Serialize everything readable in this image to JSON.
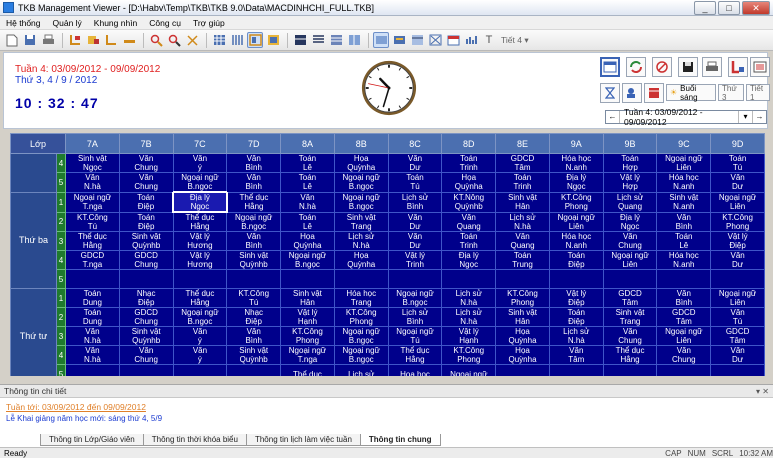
{
  "window": {
    "title": "TKB Management Viewer - [D:\\Habv\\Temp\\TKB\\TKB 9.0\\Data\\MACDINHCHI_FULL.TKB]",
    "min": "_",
    "max": "□",
    "close": "✕"
  },
  "menu": [
    "Hệ thống",
    "Quản lý",
    "Khung nhìn",
    "Công cụ",
    "Trợ giúp"
  ],
  "toolbar": {
    "tiet_label": "Tiết 4",
    "tiet_arrow": "▾"
  },
  "header": {
    "week": "Tuần 4: 03/09/2012 - 09/09/2012",
    "day": "Thứ 3, 4 / 9 / 2012",
    "time": "10 : 32 : 47",
    "session_label": "Buổi sáng",
    "day_select": "Thứ 3",
    "period_select": "Tiết 1",
    "week_select": "Tuần 4: 03/09/2012 - 09/09/2012",
    "nav_prev": "←",
    "nav_next": "→",
    "nav_drop": "▾"
  },
  "clock": {
    "hour": 10,
    "minute": 32,
    "second": 47
  },
  "grid": {
    "corner": "Lớp",
    "classes": [
      "7A",
      "7B",
      "7C",
      "7D",
      "8A",
      "8B",
      "8C",
      "8D",
      "8E",
      "9A",
      "9B",
      "9C",
      "9D"
    ],
    "sections": [
      {
        "day": "",
        "rows": [
          {
            "period": "4",
            "cells": [
              [
                "Sinh vật",
                "Ngọc"
              ],
              [
                "Văn",
                "Chung"
              ],
              [
                "Văn",
                "ý"
              ],
              [
                "Văn",
                "Bình"
              ],
              [
                "Toán",
                "Lê"
              ],
              [
                "Họa",
                "Quỳnha"
              ],
              [
                "Văn",
                "Dư"
              ],
              [
                "Toán",
                "Trinh"
              ],
              [
                "GDCD",
                "Tâm"
              ],
              [
                "Hóa học",
                "N.anh"
              ],
              [
                "Toán",
                "Hợp"
              ],
              [
                "Ngoại ngữ",
                "Liên"
              ],
              [
                "Toán",
                "Tú"
              ]
            ]
          },
          {
            "period": "5",
            "cells": [
              [
                "Văn",
                "N.hà"
              ],
              [
                "Văn",
                "Chung"
              ],
              [
                "Ngoại ngữ",
                "B.ngọc"
              ],
              [
                "Văn",
                "Bình"
              ],
              [
                "Toán",
                "Lê"
              ],
              [
                "Ngoại ngữ",
                "B.ngọc"
              ],
              [
                "Toán",
                "Tú"
              ],
              [
                "Họa",
                "Quỳnha"
              ],
              [
                "Toán",
                "Trinh"
              ],
              [
                "Địa lý",
                "Ngọc"
              ],
              [
                "Vật lý",
                "Hợp"
              ],
              [
                "Hóa học",
                "N.anh"
              ],
              [
                "Văn",
                "Dư"
              ]
            ]
          }
        ]
      },
      {
        "day": "Thứ ba",
        "rows": [
          {
            "period": "1",
            "cells": [
              [
                "Ngoại ngữ",
                "T.nga"
              ],
              [
                "Toán",
                "Điệp"
              ],
              [
                "Địa lý",
                "Ngọc"
              ],
              [
                "Thể dục",
                "Hằng"
              ],
              [
                "Văn",
                "N.hà"
              ],
              [
                "Ngoại ngữ",
                "B.ngọc"
              ],
              [
                "Lịch sử",
                "Bình"
              ],
              [
                "KT.Nông",
                "Quỳnhb"
              ],
              [
                "Sinh vật",
                "Hân"
              ],
              [
                "KT.Công",
                "Phong"
              ],
              [
                "Lịch sử",
                "Quang"
              ],
              [
                "Sinh vật",
                "N.anh"
              ],
              [
                "Ngoại ngữ",
                "Liên"
              ]
            ]
          },
          {
            "period": "2",
            "cells": [
              [
                "KT.Công",
                "Tú"
              ],
              [
                "Toán",
                "Điệp"
              ],
              [
                "Thể dục",
                "Hằng"
              ],
              [
                "Ngoại ngữ",
                "B.ngọc"
              ],
              [
                "Toán",
                "Lê"
              ],
              [
                "Sinh vật",
                "Trang"
              ],
              [
                "Văn",
                "Dư"
              ],
              [
                "Văn",
                "Quang"
              ],
              [
                "Lịch sử",
                "N.hà"
              ],
              [
                "Ngoại ngữ",
                "Liên"
              ],
              [
                "Địa lý",
                "Ngọc"
              ],
              [
                "Văn",
                "Bình"
              ],
              [
                "KT.Công",
                "Phong"
              ]
            ]
          },
          {
            "period": "3",
            "cells": [
              [
                "Thể dục",
                "Hằng"
              ],
              [
                "Sinh vật",
                "Quỳnhb"
              ],
              [
                "Vật lý",
                "Hương"
              ],
              [
                "Văn",
                "Bình"
              ],
              [
                "Họa",
                "Quỳnha"
              ],
              [
                "Lịch sử",
                "N.hà"
              ],
              [
                "Văn",
                "Dư"
              ],
              [
                "Toán",
                "Trinh"
              ],
              [
                "Văn",
                "Quang"
              ],
              [
                "Hóa học",
                "N.anh"
              ],
              [
                "Văn",
                "Chung"
              ],
              [
                "Toán",
                "Lê"
              ],
              [
                "Vật lý",
                "Điệp"
              ]
            ]
          },
          {
            "period": "4",
            "cells": [
              [
                "GDCD",
                "T.nga"
              ],
              [
                "GDCD",
                "Chung"
              ],
              [
                "Vật lý",
                "Hương"
              ],
              [
                "Sinh vật",
                "Quỳnhb"
              ],
              [
                "Ngoại ngữ",
                "B.ngọc"
              ],
              [
                "Họa",
                "Quỳnha"
              ],
              [
                "Vật lý",
                "Trinh"
              ],
              [
                "Địa lý",
                "Ngọc"
              ],
              [
                "Toán",
                "Trung"
              ],
              [
                "Toán",
                "Điệp"
              ],
              [
                "Ngoại ngữ",
                "Liên"
              ],
              [
                "Hóa học",
                "N.anh"
              ],
              [
                "Văn",
                "Dư"
              ]
            ]
          },
          {
            "period": "5",
            "cells": [
              [
                "",
                ""
              ],
              [
                "",
                ""
              ],
              [
                "",
                ""
              ],
              [
                "",
                ""
              ],
              [
                "",
                ""
              ],
              [
                "",
                ""
              ],
              [
                "",
                ""
              ],
              [
                "",
                ""
              ],
              [
                "",
                ""
              ],
              [
                "",
                ""
              ],
              [
                "",
                ""
              ],
              [
                "",
                ""
              ],
              [
                "",
                ""
              ]
            ]
          }
        ]
      },
      {
        "day": "Thứ tư",
        "rows": [
          {
            "period": "1",
            "cells": [
              [
                "Toán",
                "Dung"
              ],
              [
                "Nhạc",
                "Điệp"
              ],
              [
                "Thể dục",
                "Hằng"
              ],
              [
                "KT.Công",
                "Tú"
              ],
              [
                "Sinh vật",
                "Hân"
              ],
              [
                "Hóa học",
                "Trang"
              ],
              [
                "Ngoại ngữ",
                "B.ngọc"
              ],
              [
                "Lịch sử",
                "N.hà"
              ],
              [
                "KT.Công",
                "Phong"
              ],
              [
                "Vật lý",
                "Điệp"
              ],
              [
                "GDCD",
                "Tâm"
              ],
              [
                "Văn",
                "Bình"
              ],
              [
                "Ngoại ngữ",
                "Liên"
              ]
            ]
          },
          {
            "period": "2",
            "cells": [
              [
                "Toán",
                "Dung"
              ],
              [
                "GDCD",
                "Chung"
              ],
              [
                "Ngoại ngữ",
                "B.ngọc"
              ],
              [
                "Nhạc",
                "Điệp"
              ],
              [
                "Vật lý",
                "Hạnh"
              ],
              [
                "KT.Công",
                "Phong"
              ],
              [
                "Lịch sử",
                "Bình"
              ],
              [
                "Lịch sử",
                "N.hà"
              ],
              [
                "Sinh vật",
                "Hân"
              ],
              [
                "Toán",
                "Điệp"
              ],
              [
                "Sinh vật",
                "Trang"
              ],
              [
                "GDCD",
                "Tâm"
              ],
              [
                "Văn",
                "Tú"
              ]
            ]
          },
          {
            "period": "3",
            "cells": [
              [
                "Văn",
                "N.hà"
              ],
              [
                "Sinh vật",
                "Quỳnhb"
              ],
              [
                "Văn",
                "ý"
              ],
              [
                "Văn",
                "Bình"
              ],
              [
                "KT.Công",
                "Phong"
              ],
              [
                "Ngoại ngữ",
                "B.ngọc"
              ],
              [
                "Ngoại ngữ",
                "Tú"
              ],
              [
                "Vật lý",
                "Hạnh"
              ],
              [
                "Họa",
                "Quỳnha"
              ],
              [
                "Lịch sử",
                "N.hà"
              ],
              [
                "Văn",
                "Chung"
              ],
              [
                "Ngoại ngữ",
                "Liên"
              ],
              [
                "GDCD",
                "Tâm"
              ]
            ]
          },
          {
            "period": "4",
            "cells": [
              [
                "Văn",
                "N.hà"
              ],
              [
                "Văn",
                "Chung"
              ],
              [
                "Văn",
                "ý"
              ],
              [
                "Sinh vật",
                "Quỳnhb"
              ],
              [
                "Ngoại ngữ",
                "T.nga"
              ],
              [
                "Ngoại ngữ",
                "B.ngọc"
              ],
              [
                "Thể dục",
                "Hằng"
              ],
              [
                "KT.Công",
                "Phong"
              ],
              [
                "Họa",
                "Quỳnha"
              ],
              [
                "Văn",
                "Tâm"
              ],
              [
                "Thể dục",
                "Hằng"
              ],
              [
                "Văn",
                "Chung"
              ],
              [
                "Văn",
                "Dư"
              ]
            ]
          },
          {
            "period": "5",
            "cells": [
              [
                "",
                ""
              ],
              [
                "",
                ""
              ],
              [
                "",
                ""
              ],
              [
                "",
                ""
              ],
              [
                "Thể dục",
                ""
              ],
              [
                "Lịch sử",
                ""
              ],
              [
                "Họa hoc",
                ""
              ],
              [
                "Ngoại ngữ",
                ""
              ],
              [
                "",
                ""
              ],
              [
                "",
                ""
              ],
              [
                "",
                ""
              ],
              [
                "",
                ""
              ],
              [
                "",
                ""
              ]
            ]
          }
        ]
      }
    ]
  },
  "info": {
    "title": "Thông tin chi tiết",
    "line1": "Tuần tới: 03/09/2012 đến 09/09/2012",
    "line2": "Lễ Khai giảng năm học mới: sáng thứ 4, 5/9",
    "tabs": [
      "Thông tin Lớp/Giáo viên",
      "Thông tin thời khóa biểu",
      "Thông tin lịch làm việc tuần",
      "Thông tin chung"
    ]
  },
  "status": {
    "text": "Ready",
    "cap": "CAP",
    "num": "NUM",
    "scrl": "SCRL",
    "time": "10:32 AM"
  }
}
